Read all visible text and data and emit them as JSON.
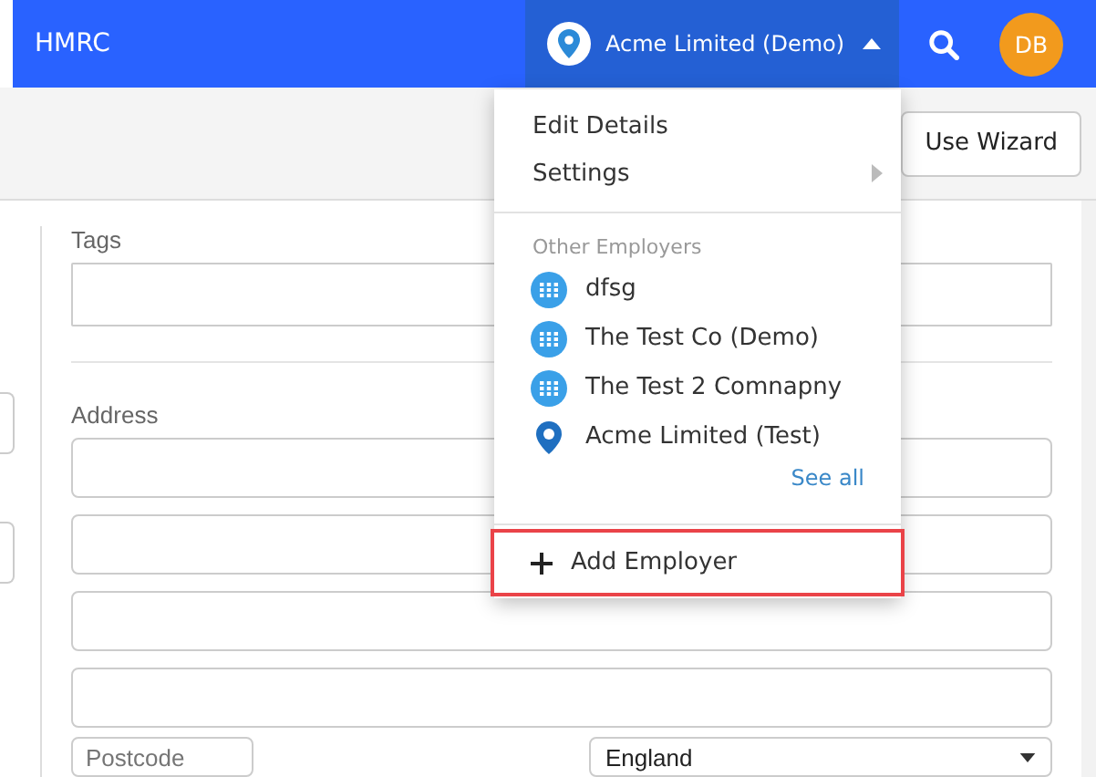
{
  "header": {
    "title": "HMRC",
    "employer": {
      "name": "Acme Limited (Demo)",
      "expanded": true
    },
    "avatar": "DB"
  },
  "toolbar": {
    "button": "Use Wizard"
  },
  "form": {
    "tags_label": "Tags",
    "address_label": "Address",
    "postcode_placeholder": "Postcode",
    "country": "England"
  },
  "menu": {
    "items": [
      {
        "label": "Edit Details",
        "submenu": false
      },
      {
        "label": "Settings",
        "submenu": true
      }
    ],
    "section_title": "Other Employers",
    "employers": [
      {
        "name": "dfsg",
        "kind": "building"
      },
      {
        "name": "The Test Co (Demo)",
        "kind": "building"
      },
      {
        "name": "The Test 2 Comnapny",
        "kind": "building"
      },
      {
        "name": "Acme Limited (Test)",
        "kind": "pin"
      }
    ],
    "see_all": "See all",
    "add": {
      "label": "Add Employer",
      "highlighted": true
    }
  }
}
